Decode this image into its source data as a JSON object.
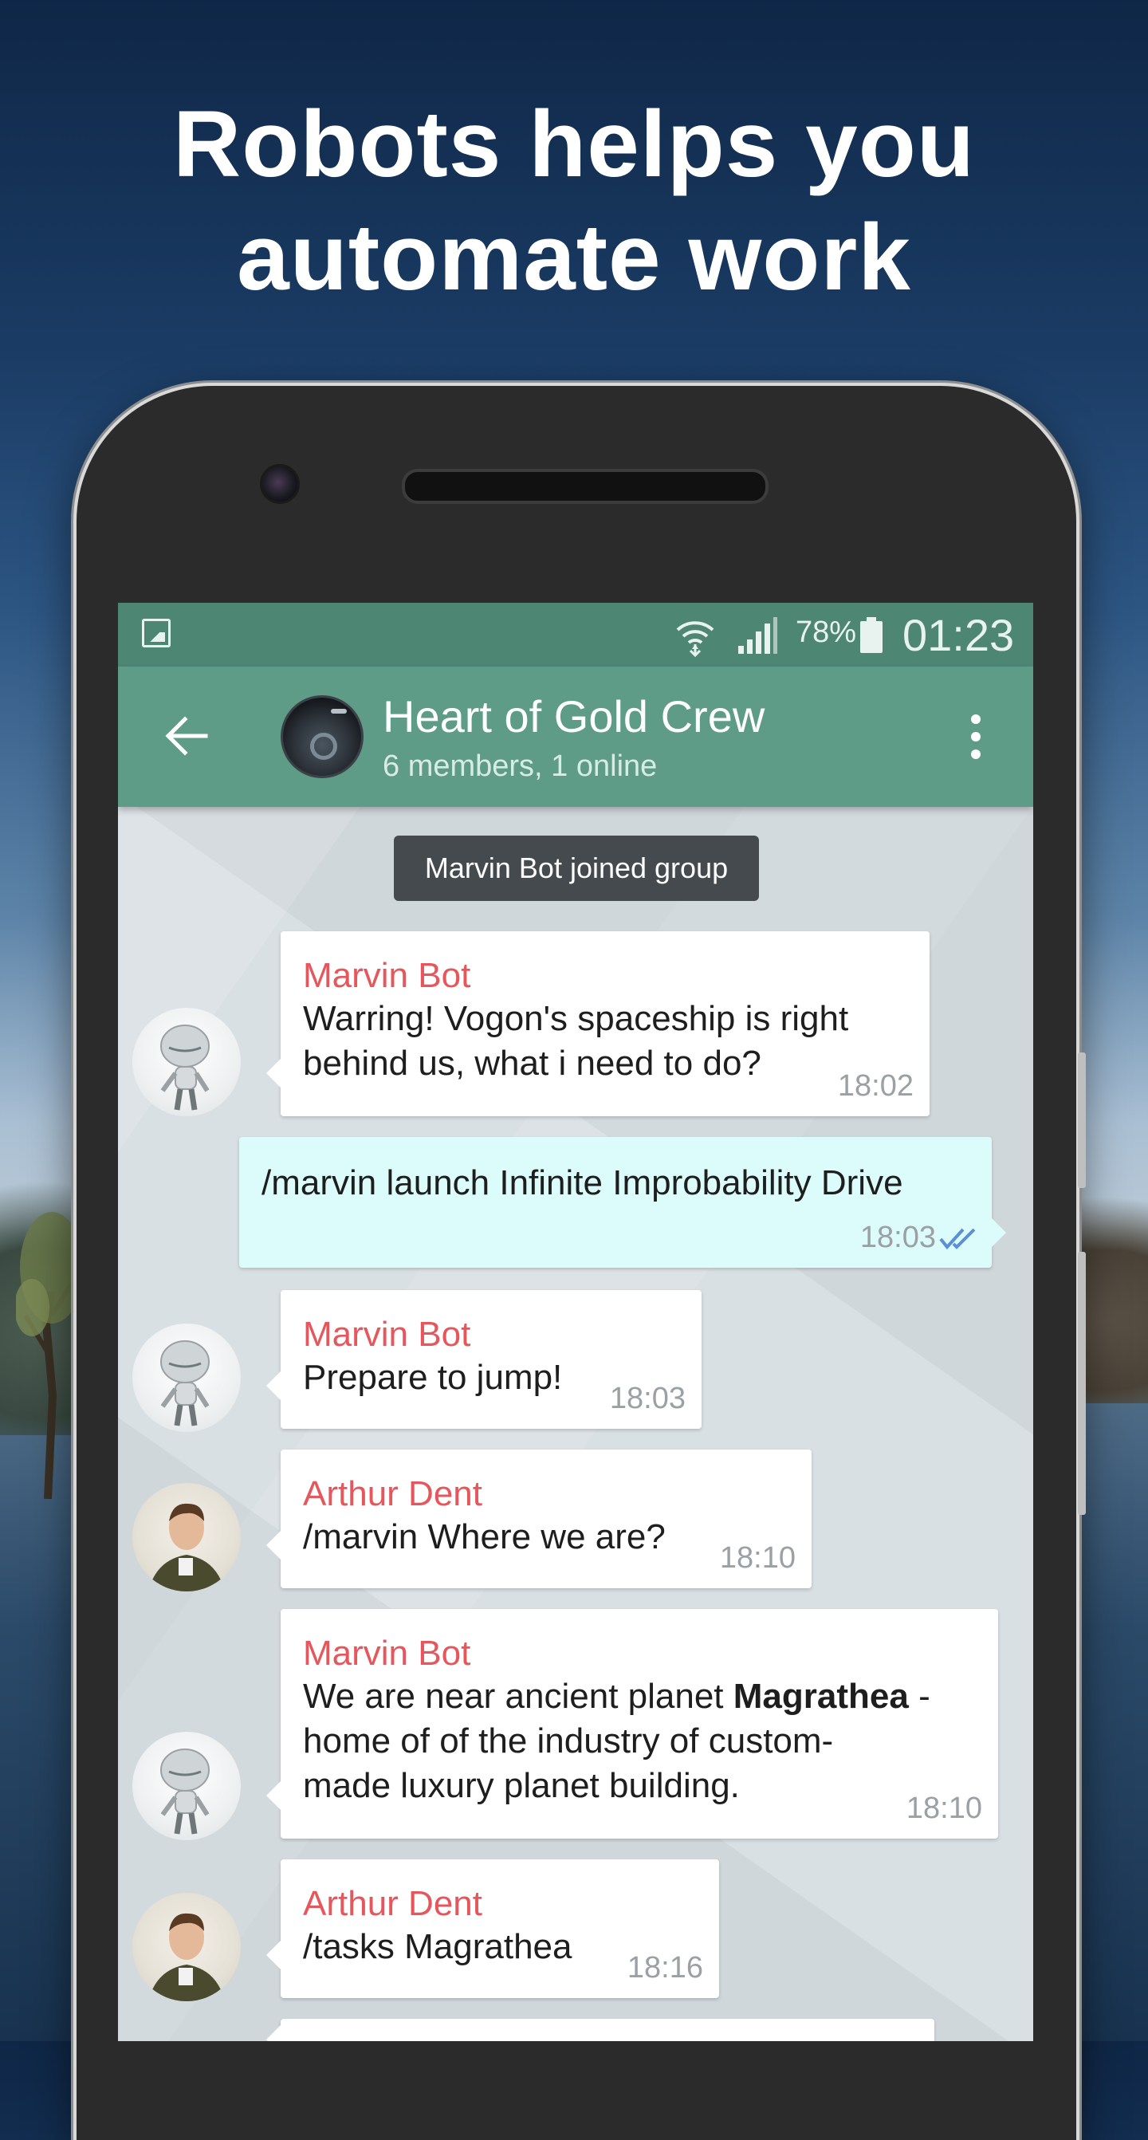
{
  "headline": {
    "line1": "Robots helps you",
    "line2": "automate work"
  },
  "status_bar": {
    "battery": "78%",
    "time": "01:23",
    "icons": [
      "image-icon",
      "wifi-icon",
      "signal-icon",
      "battery-icon"
    ]
  },
  "chat_header": {
    "title": "Heart of Gold Crew",
    "subtitle": "6 members, 1 online"
  },
  "service_message": "Marvin Bot joined group",
  "messages": [
    {
      "sender": "Marvin Bot",
      "line1": "Warring! Vogon's spaceship is right",
      "line2": "behind us, what i need to do?",
      "time": "18:02"
    },
    {
      "line1": "/marvin launch Infinite Improbability Drive",
      "time": "18:03",
      "status": "read"
    },
    {
      "sender": "Marvin Bot",
      "line1": "Prepare to jump!",
      "time": "18:03"
    },
    {
      "sender": "Arthur Dent",
      "line1": "/marvin Where we are?",
      "time": "18:10"
    },
    {
      "sender": "Marvin Bot",
      "line1a": "We are near ancient planet ",
      "line1b": "Magrathea",
      "line1c": " -",
      "line2": "home of of the industry of custom-",
      "line3": "made luxury planet building.",
      "time": "18:10"
    },
    {
      "sender": "Arthur Dent",
      "line1": "/tasks Magrathea",
      "time": "18:16"
    }
  ],
  "colors": {
    "status_bar": "#4e8674",
    "app_bar": "#5e9c87",
    "sender_name": "#e5575c",
    "outgoing_bubble": "#dcfbfb",
    "read_ticks": "#5b8fd6"
  }
}
